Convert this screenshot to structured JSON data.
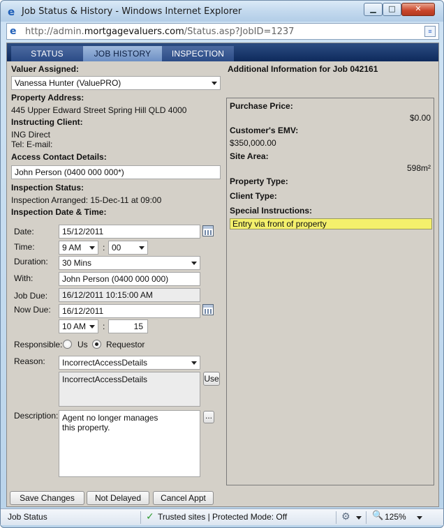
{
  "window": {
    "title": "Job Status & History - Windows Internet Explorer",
    "url_prefix": "http://admin.",
    "url_domain": "mortgagevaluers.com",
    "url_path": "/Status.asp?JobID=1237"
  },
  "tabs": [
    {
      "label": "STATUS"
    },
    {
      "label": "JOB HISTORY"
    },
    {
      "label": "INSPECTION"
    }
  ],
  "left": {
    "valuer_label": "Valuer Assigned:",
    "valuer_value": "Vanessa Hunter (ValuePRO)",
    "address_label": "Property Address:",
    "address_value": "445 Upper Edward Street  Spring Hill QLD 4000",
    "client_label": "Instructing Client:",
    "client_name": "ING Direct",
    "client_contact": "Tel:  E-mail:",
    "access_label": "Access Contact Details:",
    "access_value": "John Person (0400 000 000*)",
    "inspection_status_label": "Inspection Status:",
    "inspection_status_value": "Inspection Arranged: 15-Dec-11 at 09:00",
    "inspection_dt_label": "Inspection Date & Time:"
  },
  "form": {
    "date_label": "Date:",
    "date_value": "15/12/2011",
    "time_label": "Time:",
    "time_hour": "9 AM",
    "time_sep": ":",
    "time_min": "00",
    "duration_label": "Duration:",
    "duration_value": "30 Mins",
    "with_label": "With:",
    "with_value": "John Person (0400 000 000)",
    "jobdue_label": "Job Due:",
    "jobdue_value": "16/12/2011 10:15:00 AM",
    "nowdue_label": "Now Due:",
    "nowdue_value": "16/12/2011",
    "nowdue_hour": "10 AM",
    "nowdue_sep": ":",
    "nowdue_min": "15",
    "responsible_label": "Responsible:",
    "resp_us": "Us",
    "resp_requestor": "Requestor",
    "reason_label": "Reason:",
    "reason_value": "IncorrectAccessDetails",
    "reason_text": "IncorrectAccessDetails",
    "use_label": "Use",
    "description_label": "Description:",
    "description_value": "Agent no longer manages this property.",
    "more_label": "..."
  },
  "right": {
    "header": "Additional Information for Job 042161",
    "purchase_label": "Purchase Price:",
    "purchase_value": "$0.00",
    "emv_label": "Customer's EMV:",
    "emv_value": "$350,000.00",
    "site_label": "Site Area:",
    "site_value": "598m²",
    "ptype_label": "Property Type:",
    "ctype_label": "Client Type:",
    "special_label": "Special Instructions:",
    "special_value": "Entry via front of property"
  },
  "buttons": {
    "save": "Save Changes",
    "not_delayed": "Not Delayed",
    "cancel": "Cancel Appt"
  },
  "statusbar": {
    "left": "Job Status",
    "zone": "Trusted sites | Protected Mode: Off",
    "zoom": "125%"
  }
}
